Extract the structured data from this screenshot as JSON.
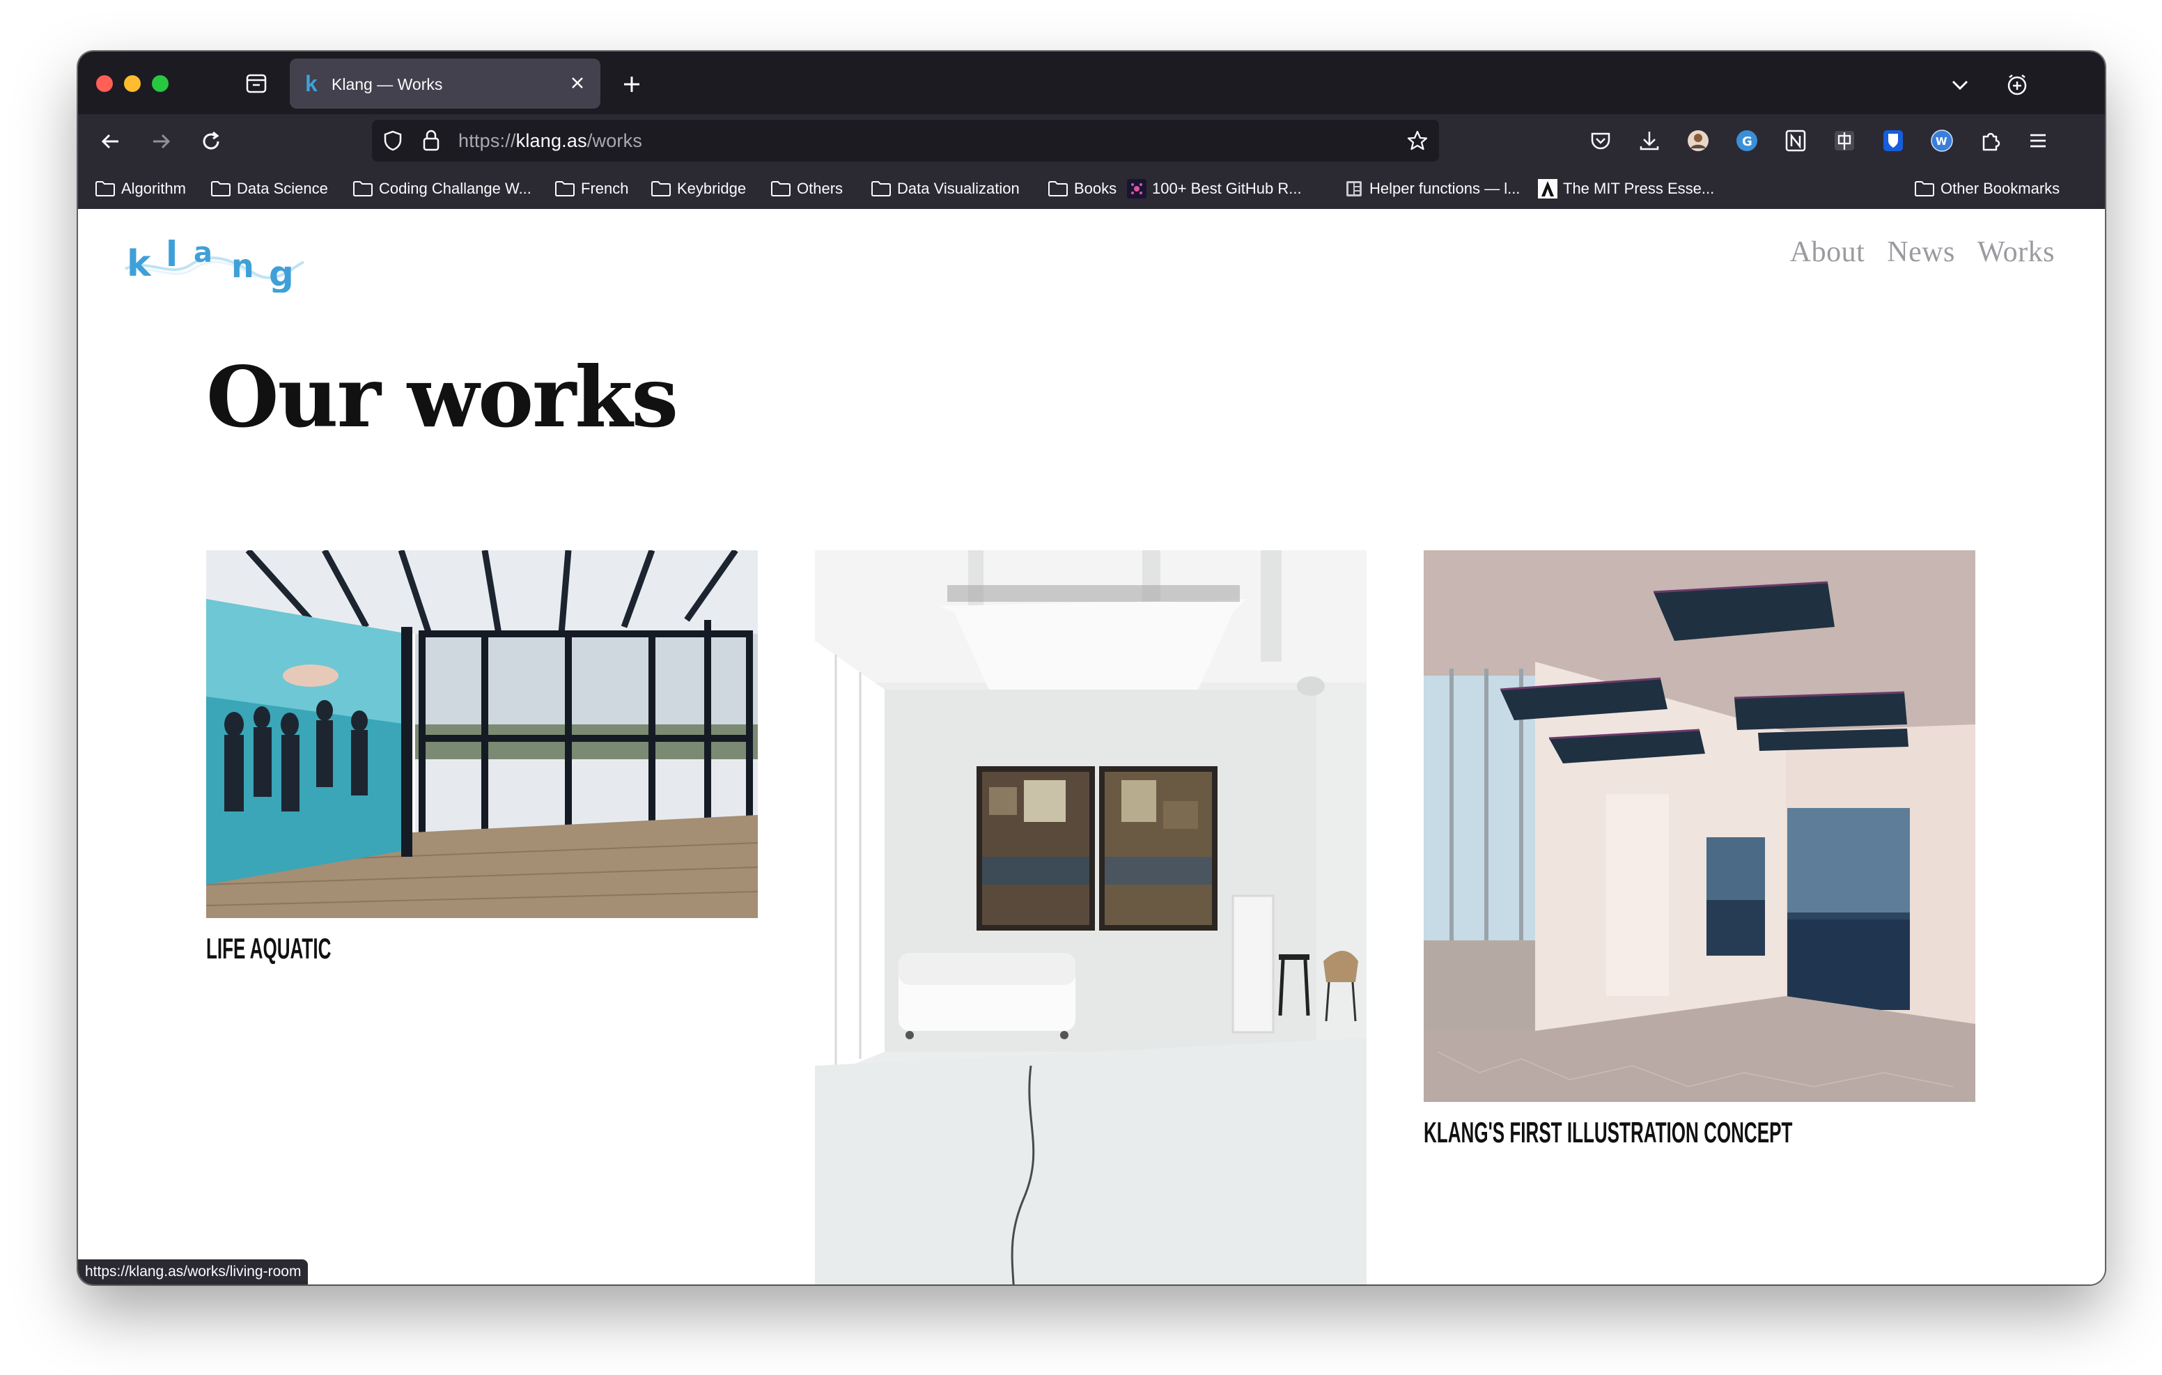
{
  "browser": {
    "tab": {
      "title": "Klang — Works",
      "favicon": "k"
    },
    "url": {
      "prefix": "https://",
      "host": "klang.as",
      "path": "/works"
    },
    "bookmarks": [
      {
        "label": "Algorithm",
        "type": "folder"
      },
      {
        "label": "Data Science",
        "type": "folder"
      },
      {
        "label": "Coding Challange W...",
        "type": "folder"
      },
      {
        "label": "French",
        "type": "folder"
      },
      {
        "label": "Keybridge",
        "type": "folder"
      },
      {
        "label": "Others",
        "type": "folder"
      },
      {
        "label": "Data Visualization",
        "type": "folder"
      },
      {
        "label": "Books",
        "type": "folder"
      },
      {
        "label": "100+ Best GitHub R...",
        "type": "link"
      },
      {
        "label": "Helper functions — l...",
        "type": "link"
      },
      {
        "label": "The MIT Press Esse...",
        "type": "link"
      }
    ],
    "other_bookmarks": "Other Bookmarks",
    "status_url": "https://klang.as/works/living-room"
  },
  "site": {
    "logo_text": "klang",
    "nav": [
      "About",
      "News",
      "Works"
    ],
    "page_title": "Our works",
    "works": [
      {
        "title": "LIFE AQUATIC",
        "image": "glass-room-with-ocean-projection"
      },
      {
        "title": "",
        "image": "white-loft-with-two-panel-artwork"
      },
      {
        "title": "KLANG'S FIRST ILLUSTRATION CONCEPT",
        "image": "pink-room-with-ocean-panels"
      }
    ]
  },
  "colors": {
    "tabstrip": "#1c1b22",
    "toolbar": "#2b2a33",
    "accent_logo": "#3fa0d8",
    "nav_link": "#9a9aa0"
  }
}
